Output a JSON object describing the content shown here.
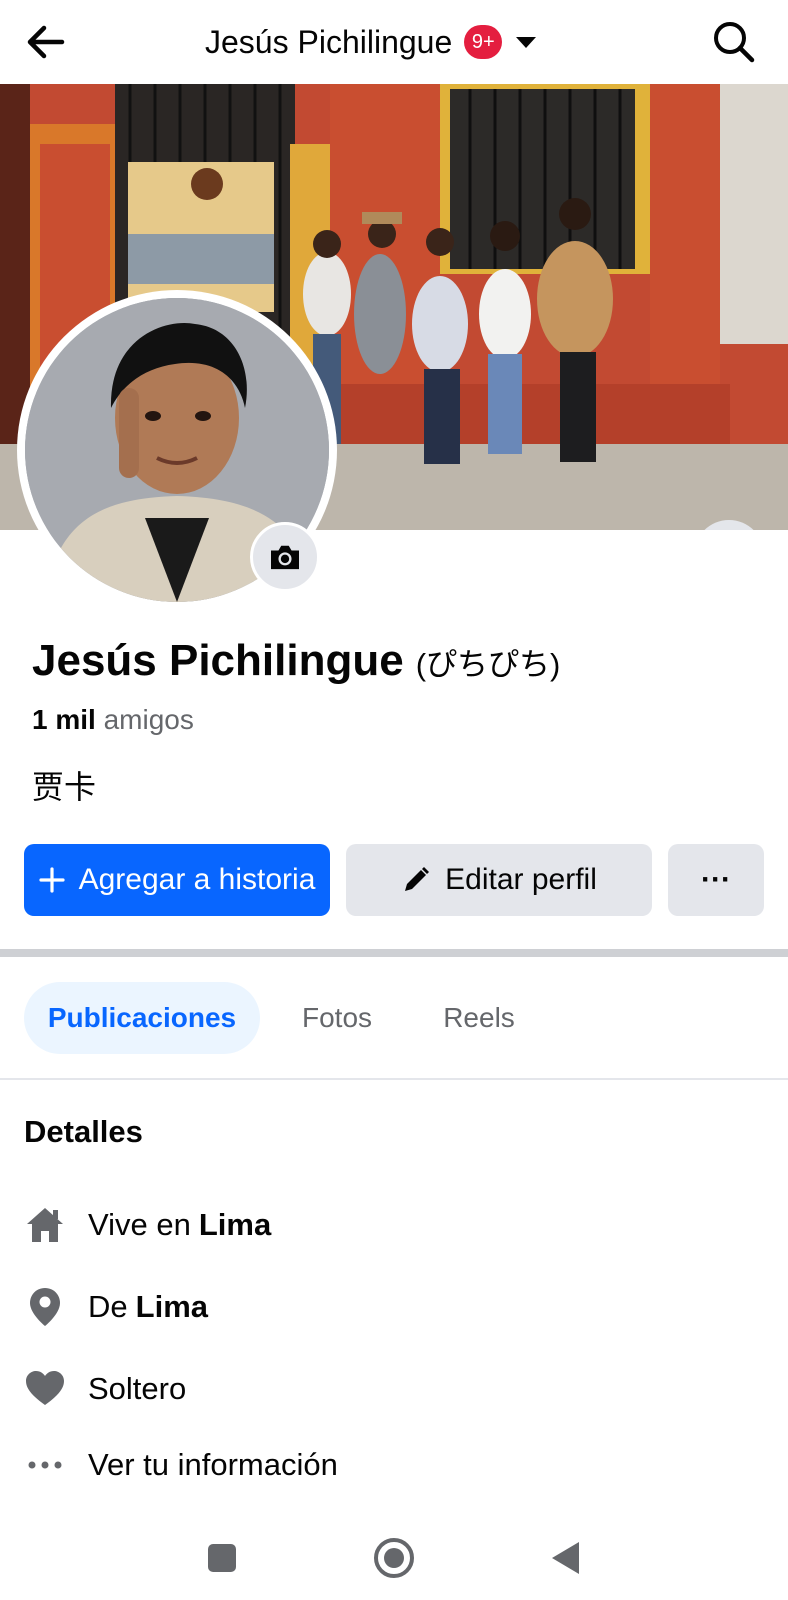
{
  "header": {
    "title": "Jesús Pichilingue",
    "badge": "9+"
  },
  "profile": {
    "name": "Jesús Pichilingue",
    "alt_name": "(ぴちぴち)",
    "friends_count": "1 mil",
    "friends_label": "amigos",
    "bio": "贾卡"
  },
  "actions": {
    "add_story": "Agregar a historia",
    "edit_profile": "Editar perfil",
    "more": "···"
  },
  "tabs": [
    {
      "label": "Publicaciones",
      "active": true
    },
    {
      "label": "Fotos",
      "active": false
    },
    {
      "label": "Reels",
      "active": false
    }
  ],
  "details": {
    "title": "Detalles",
    "items": [
      {
        "icon": "home-icon",
        "prefix": "Vive en",
        "value": "Lima"
      },
      {
        "icon": "location-pin-icon",
        "prefix": "De",
        "value": "Lima"
      },
      {
        "icon": "heart-icon",
        "prefix": "Soltero",
        "value": ""
      },
      {
        "icon": "more-dots-icon",
        "prefix": "Ver tu información",
        "value": ""
      }
    ]
  },
  "colors": {
    "primary": "#0866ff",
    "badge": "#e41e3f",
    "secondary_button": "#e4e6eb",
    "muted_text": "#65676b"
  }
}
